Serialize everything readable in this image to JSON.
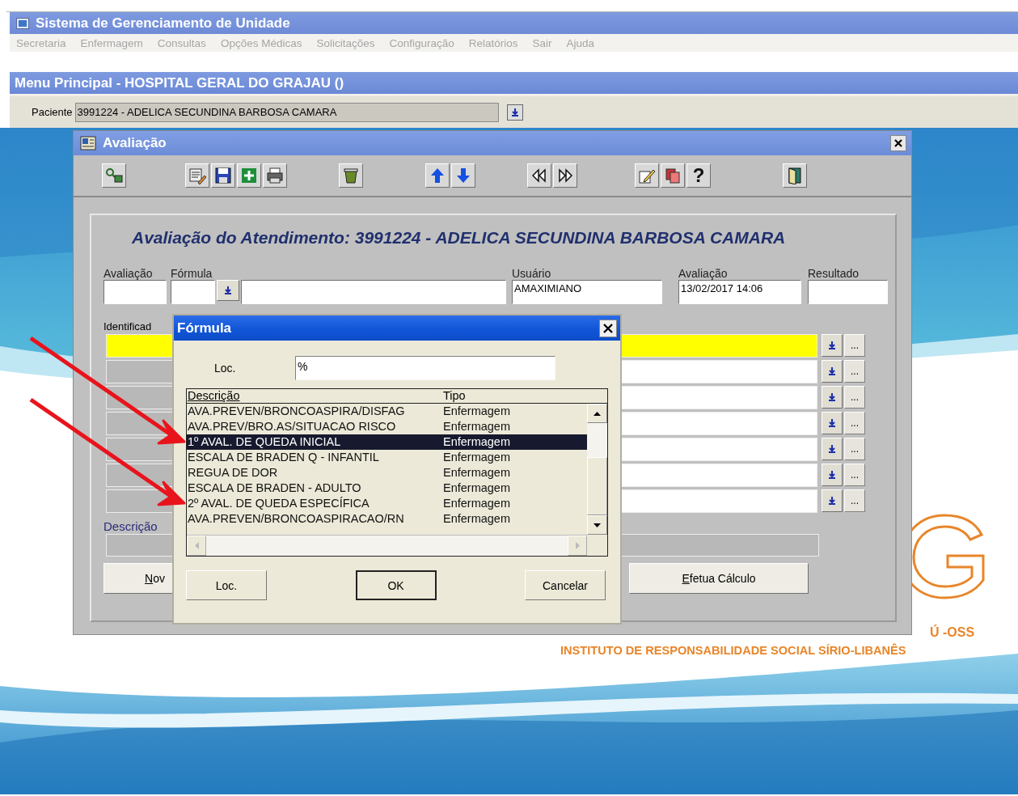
{
  "app": {
    "title": "Sistema de Gerenciamento de Unidade"
  },
  "menu": [
    "Secretaria",
    "Enfermagem",
    "Consultas",
    "Opções Médicas",
    "Solicitações",
    "Configuração",
    "Relatórios",
    "Sair",
    "Ajuda"
  ],
  "main_menu_title": "Menu Principal - HOSPITAL GERAL DO GRAJAU ()",
  "patient": {
    "label": "Paciente",
    "value": "3991224 - ADELICA SECUNDINA BARBOSA CAMARA"
  },
  "window": {
    "title": "Avaliação",
    "toolbar": [
      [
        {
          "kind": "query"
        }
      ],
      [
        {
          "kind": "edit"
        },
        {
          "kind": "save"
        },
        {
          "kind": "add"
        },
        {
          "kind": "print"
        }
      ],
      [
        {
          "kind": "delete"
        }
      ],
      [
        {
          "kind": "up"
        },
        {
          "kind": "down"
        }
      ],
      [
        {
          "kind": "first"
        },
        {
          "kind": "last"
        }
      ],
      [
        {
          "kind": "pencil"
        },
        {
          "kind": "copy"
        },
        {
          "kind": "help",
          "label": "?"
        }
      ],
      [
        {
          "kind": "exit"
        }
      ]
    ],
    "heading": "Avaliação do Atendimento: 3991224 - ADELICA SECUNDINA BARBOSA CAMARA",
    "fields": [
      {
        "kind": "text",
        "label": "Avaliação"
      },
      {
        "kind": "lookup",
        "label": "Fórmula"
      },
      {
        "kind": "text",
        "label": "Usuário",
        "value": "AMAXIMIANO"
      },
      {
        "kind": "text",
        "label": "Avaliação",
        "value": "13/02/2017 14:06"
      },
      {
        "kind": "text",
        "label": "Resultado"
      }
    ],
    "identifier_label": "Identificad",
    "identifier_rows": [
      {
        "highlighted": true
      },
      {
        "highlighted": false
      },
      {
        "highlighted": false
      },
      {
        "highlighted": false
      },
      {
        "highlighted": false
      },
      {
        "highlighted": false
      },
      {
        "highlighted": false
      }
    ],
    "more_label": "...",
    "description_label": "Descrição",
    "buttons": [
      {
        "label": "Nov"
      },
      {
        "label": "Efetua Cálculo"
      }
    ]
  },
  "dialog": {
    "title": "Fórmula",
    "search_label": "Loc.",
    "search_value": "%",
    "columns": [
      "Descrição",
      "Tipo"
    ],
    "rows": [
      {
        "description": "AVA.PREVEN/BRONCOASPIRA/DISFAG",
        "type": "Enfermagem",
        "selected": false,
        "arrow_marked": false
      },
      {
        "description": "AVA.PREV/BRO.AS/SITUACAO RISCO",
        "type": "Enfermagem",
        "selected": false,
        "arrow_marked": false
      },
      {
        "description": "1º AVAL. DE QUEDA INICIAL",
        "type": "Enfermagem",
        "selected": true,
        "arrow_marked": true
      },
      {
        "description": "ESCALA DE BRADEN Q - INFANTIL",
        "type": "Enfermagem",
        "selected": false,
        "arrow_marked": false
      },
      {
        "description": "REGUA DE DOR",
        "type": "Enfermagem",
        "selected": false,
        "arrow_marked": false
      },
      {
        "description": "ESCALA DE BRADEN - ADULTO",
        "type": "Enfermagem",
        "selected": false,
        "arrow_marked": false
      },
      {
        "description": "2º AVAL. DE QUEDA ESPECÍFICA",
        "type": "Enfermagem",
        "selected": false,
        "arrow_marked": true
      },
      {
        "description": "AVA.PREVEN/BRONCOASPIRACAO/RN",
        "type": "Enfermagem",
        "selected": false,
        "arrow_marked": false
      }
    ],
    "buttons": [
      {
        "label": "Loc.",
        "default": false
      },
      {
        "label": "OK",
        "default": true
      },
      {
        "label": "Cancelar",
        "default": false
      }
    ]
  },
  "logo": {
    "line_1": "Ú -OSS",
    "line_2": "INSTITUTO DE RESPONSABILIDADE SOCIAL SÍRIO-LIBANÊS"
  }
}
